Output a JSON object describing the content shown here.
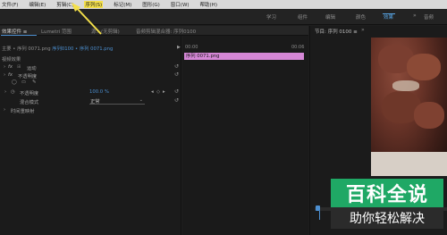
{
  "menu": {
    "items": [
      "文件(F)",
      "编辑(E)",
      "剪辑(C)",
      "序列(S)",
      "标记(M)",
      "图形(G)",
      "窗口(W)",
      "帮助(H)"
    ],
    "active_index": 3
  },
  "workspaces": {
    "items": [
      "学习",
      "组件",
      "编辑",
      "颜色",
      "效果",
      "音频"
    ],
    "active": "效果",
    "more": "»"
  },
  "panel_tabs": {
    "items": [
      "效果控件 ≡",
      "Lumetri 范围",
      "源：(无剪辑)",
      "音频剪辑混合器: 序列0100"
    ],
    "active_index": 0
  },
  "effect_controls": {
    "clip_selector": "主要 • 序列 0071.png",
    "clip_sequence": "序列0100 • 序列 0071.png",
    "timecode_left": "00:00",
    "timecode_right": "00:06",
    "clip_bar_label": "序列 0071.png",
    "video_effects_header": "视频效果",
    "motion": "运动",
    "opacity": "不透明度",
    "opacity_prop": "不透明度",
    "opacity_value": "100.0 %",
    "blend_mode_label": "混合模式",
    "blend_mode_value": "正常",
    "time_remap": "时间重映射"
  },
  "program": {
    "title": "节目: 序列 0100 ≡"
  },
  "watermark": {
    "top": "百科全说",
    "bottom": "助你轻松解决"
  },
  "colors": {
    "accent": "#4c8fd0",
    "clip": "#d587d6",
    "annotation_arrow": "#f4e04a",
    "watermark_green": "#1fa865"
  }
}
